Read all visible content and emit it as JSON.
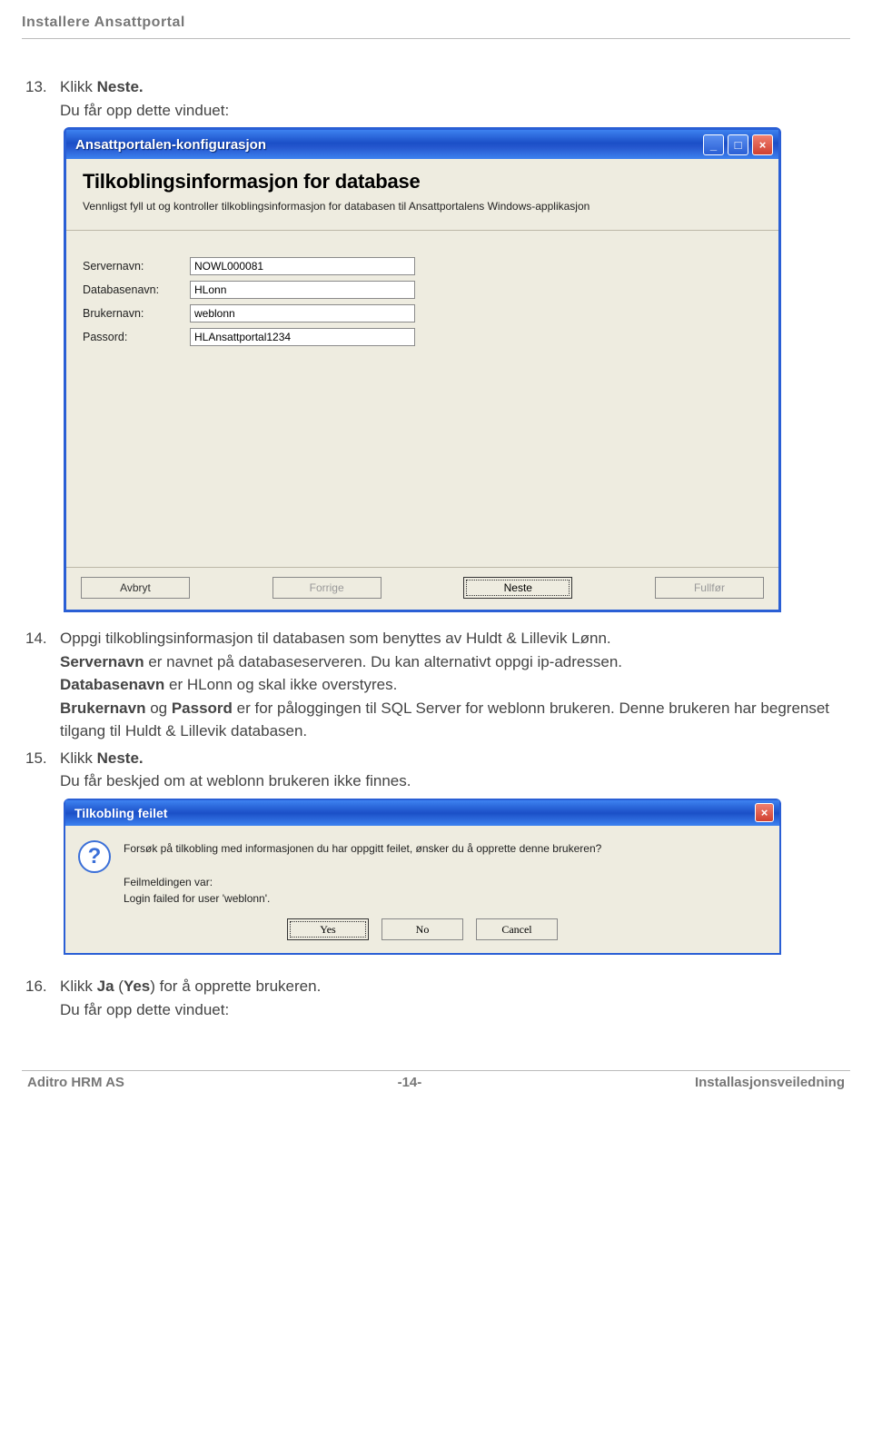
{
  "page": {
    "header": "Installere Ansattportal"
  },
  "step13": {
    "num": "13.",
    "line1_pre": "Klikk ",
    "line1_bold": "Neste.",
    "line2": "Du får opp dette vinduet:"
  },
  "dialog1": {
    "title": "Ansattportalen-konfigurasjon",
    "heading": "Tilkoblingsinformasjon for database",
    "intro": "Vennligst fyll ut og kontroller tilkoblingsinformasjon for databasen til Ansattportalens Windows-applikasjon",
    "fields": {
      "server_label": "Servernavn:",
      "server_value": "NOWL000081",
      "db_label": "Databasenavn:",
      "db_value": "HLonn",
      "user_label": "Brukernavn:",
      "user_value": "weblonn",
      "pwd_label": "Passord:",
      "pwd_value": "HLAnsattportal1234"
    },
    "buttons": {
      "cancel": "Avbryt",
      "prev": "Forrige",
      "next": "Neste",
      "finish": "Fullfør"
    }
  },
  "step14": {
    "num": "14.",
    "p1": "Oppgi tilkoblingsinformasjon til databasen som benyttes av Huldt & Lillevik Lønn.",
    "p2_bold": "Servernavn",
    "p2_rest": " er navnet på databaseserveren. Du kan alternativt oppgi ip-adressen.",
    "p3_bold": "Databasenavn",
    "p3_rest": " er HLonn og skal ikke overstyres.",
    "p4_b1": "Brukernavn",
    "p4_mid": " og ",
    "p4_b2": "Passord",
    "p4_rest": " er for påloggingen til SQL Server for weblonn brukeren. Denne brukeren har begrenset tilgang til Huldt & Lillevik databasen."
  },
  "step15": {
    "num": "15.",
    "line1_pre": "Klikk ",
    "line1_bold": "Neste.",
    "line2": "Du får beskjed om at weblonn brukeren ikke finnes."
  },
  "dialog2": {
    "title": "Tilkobling feilet",
    "icon": "?",
    "line1": "Forsøk på tilkobling med informasjonen du har oppgitt feilet, ønsker du å opprette denne brukeren?",
    "line2": "Feilmeldingen var:",
    "line3": "Login failed for user 'weblonn'.",
    "buttons": {
      "yes": "Yes",
      "no": "No",
      "cancel": "Cancel"
    }
  },
  "step16": {
    "num": "16.",
    "pre": "Klikk ",
    "b1": "Ja",
    "mid": " (",
    "b2": "Yes",
    "rest": ") for å opprette brukeren.",
    "line2": "Du får opp dette vinduet:"
  },
  "footer": {
    "left": "Aditro HRM AS",
    "center": "-14-",
    "right": "Installasjonsveiledning"
  }
}
